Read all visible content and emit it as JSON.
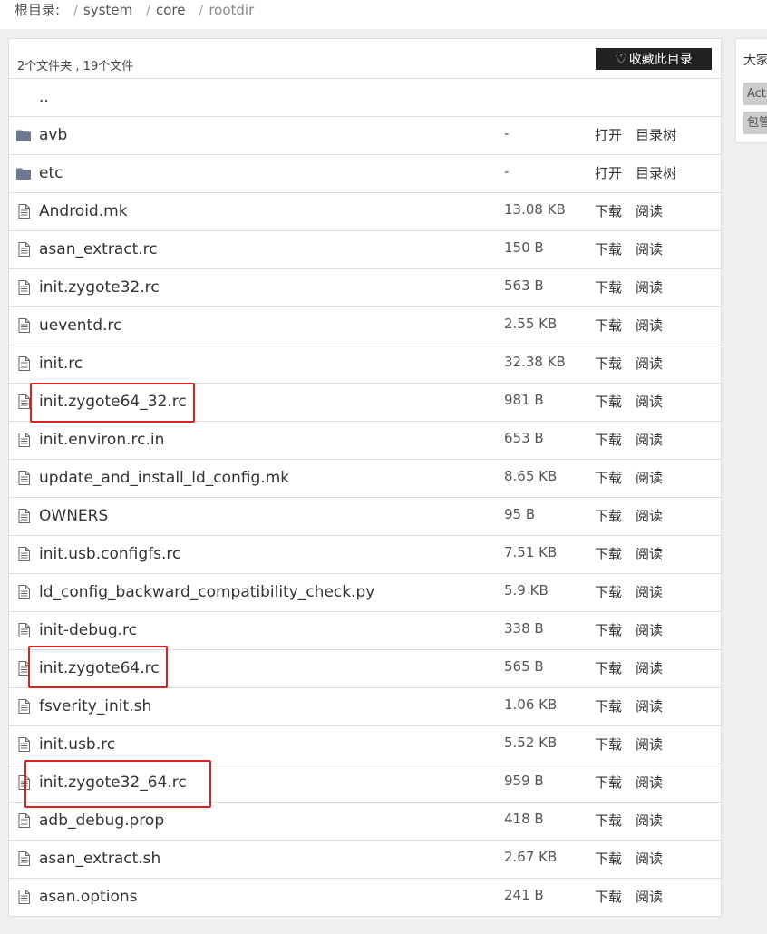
{
  "breadcrumb": {
    "root_label": "根目录:",
    "items": [
      "system",
      "core",
      "rootdir"
    ]
  },
  "header": {
    "summary": "2个文件夹 , 19个文件",
    "favorite_button": "收藏此目录"
  },
  "parent_link": "..",
  "rows": [
    {
      "type": "folder",
      "name": "avb",
      "size": "-",
      "action1": "打开",
      "action2": "目录树"
    },
    {
      "type": "folder",
      "name": "etc",
      "size": "-",
      "action1": "打开",
      "action2": "目录树"
    },
    {
      "type": "file",
      "name": "Android.mk",
      "size": "13.08 KB",
      "action1": "下载",
      "action2": "阅读"
    },
    {
      "type": "file",
      "name": "asan_extract.rc",
      "size": "150 B",
      "action1": "下载",
      "action2": "阅读"
    },
    {
      "type": "file",
      "name": "init.zygote32.rc",
      "size": "563 B",
      "action1": "下载",
      "action2": "阅读"
    },
    {
      "type": "file",
      "name": "ueventd.rc",
      "size": "2.55 KB",
      "action1": "下载",
      "action2": "阅读"
    },
    {
      "type": "file",
      "name": "init.rc",
      "size": "32.38 KB",
      "action1": "下载",
      "action2": "阅读"
    },
    {
      "type": "file",
      "name": "init.zygote64_32.rc",
      "size": "981 B",
      "action1": "下载",
      "action2": "阅读"
    },
    {
      "type": "file",
      "name": "init.environ.rc.in",
      "size": "653 B",
      "action1": "下载",
      "action2": "阅读"
    },
    {
      "type": "file",
      "name": "update_and_install_ld_config.mk",
      "size": "8.65 KB",
      "action1": "下载",
      "action2": "阅读"
    },
    {
      "type": "file",
      "name": "OWNERS",
      "size": "95 B",
      "action1": "下载",
      "action2": "阅读"
    },
    {
      "type": "file",
      "name": "init.usb.configfs.rc",
      "size": "7.51 KB",
      "action1": "下载",
      "action2": "阅读"
    },
    {
      "type": "file",
      "name": "ld_config_backward_compatibility_check.py",
      "size": "5.9 KB",
      "action1": "下载",
      "action2": "阅读"
    },
    {
      "type": "file",
      "name": "init-debug.rc",
      "size": "338 B",
      "action1": "下载",
      "action2": "阅读"
    },
    {
      "type": "file",
      "name": "init.zygote64.rc",
      "size": "565 B",
      "action1": "下载",
      "action2": "阅读"
    },
    {
      "type": "file",
      "name": "fsverity_init.sh",
      "size": "1.06 KB",
      "action1": "下载",
      "action2": "阅读"
    },
    {
      "type": "file",
      "name": "init.usb.rc",
      "size": "5.52 KB",
      "action1": "下载",
      "action2": "阅读"
    },
    {
      "type": "file",
      "name": "init.zygote32_64.rc",
      "size": "959 B",
      "action1": "下载",
      "action2": "阅读"
    },
    {
      "type": "file",
      "name": "adb_debug.prop",
      "size": "418 B",
      "action1": "下载",
      "action2": "阅读"
    },
    {
      "type": "file",
      "name": "asan_extract.sh",
      "size": "2.67 KB",
      "action1": "下载",
      "action2": "阅读"
    },
    {
      "type": "file",
      "name": "asan.options",
      "size": "241 B",
      "action1": "下载",
      "action2": "阅读"
    }
  ],
  "sidebar": {
    "title": "大家",
    "tags": [
      "Acti",
      "包管"
    ]
  },
  "colors": {
    "highlight": "#e02020",
    "folder_icon": "#6b7a90",
    "button_bg": "#222222"
  }
}
